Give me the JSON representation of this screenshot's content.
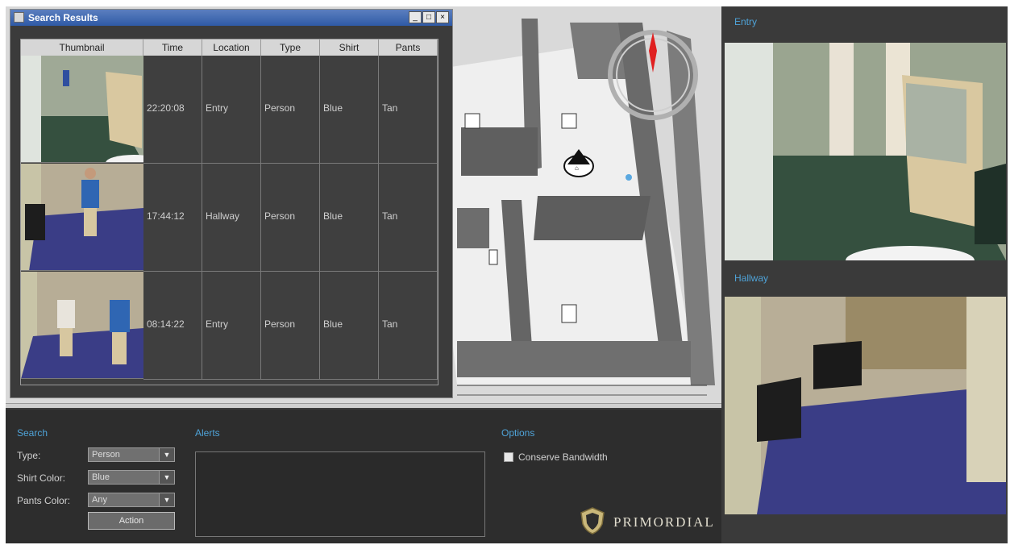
{
  "results_window": {
    "title": "Search Results",
    "buttons": {
      "minimize": "_",
      "maximize": "□",
      "close": "×"
    },
    "columns": [
      "Thumbnail",
      "Time",
      "Location",
      "Type",
      "Shirt",
      "Pants"
    ],
    "rows": [
      {
        "time": "22:20:08",
        "location": "Entry",
        "type": "Person",
        "shirt": "Blue",
        "pants": "Tan"
      },
      {
        "time": "17:44:12",
        "location": "Hallway",
        "type": "Person",
        "shirt": "Blue",
        "pants": "Tan"
      },
      {
        "time": "08:14:22",
        "location": "Entry",
        "type": "Person",
        "shirt": "Blue",
        "pants": "Tan"
      }
    ]
  },
  "controls": {
    "search_label": "Search",
    "type_label": "Type:",
    "type_value": "Person",
    "shirt_label": "Shirt Color:",
    "shirt_value": "Blue",
    "pants_label": "Pants Color:",
    "pants_value": "Any",
    "action_label": "Action",
    "alerts_label": "Alerts",
    "options_label": "Options",
    "conserve_label": "Conserve Bandwidth"
  },
  "brand": {
    "name": "PRIMORDIAL"
  },
  "cameras": [
    {
      "title": "Entry"
    },
    {
      "title": "Hallway"
    }
  ],
  "colors": {
    "accent": "#4fa3d8",
    "titlebar": "#2f5aa6",
    "panel": "#2d2d2d"
  }
}
